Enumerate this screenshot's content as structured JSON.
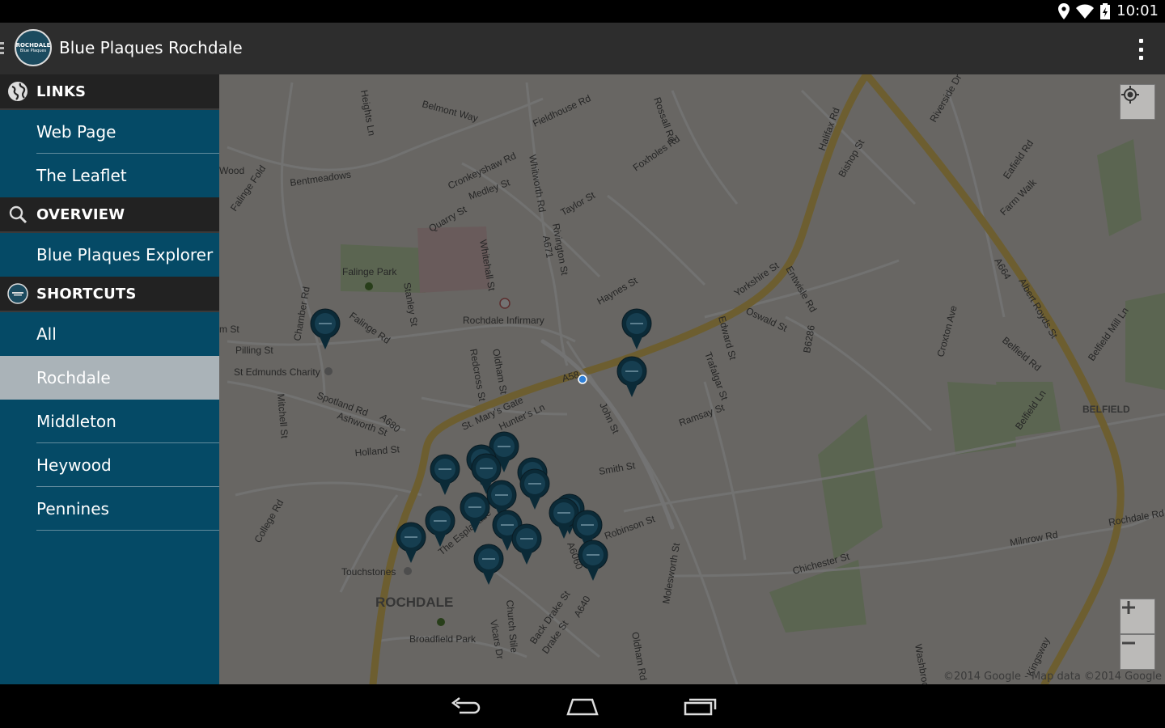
{
  "status_bar": {
    "time": "10:01",
    "icons": [
      "location-icon",
      "wifi-icon",
      "battery-icon"
    ]
  },
  "app": {
    "title": "Blue Plaques Rochdale",
    "logo_line1": "ROCHDALE",
    "logo_line2": "Blue Plaques"
  },
  "drawer": {
    "links_header": "LINKS",
    "links": [
      "Web Page",
      "The Leaflet"
    ],
    "overview_header": "OVERVIEW",
    "overview": [
      "Blue Plaques Explorer"
    ],
    "shortcuts_header": "SHORTCUTS",
    "shortcuts": [
      "All",
      "Rochdale",
      "Middleton",
      "Heywood",
      "Pennines"
    ],
    "selected": "Rochdale"
  },
  "map": {
    "copyright": "©2014 Google - Map data ©2014 Google",
    "labels": [
      "Heights Ln",
      "Belmont Way",
      "Fieldhouse Rd",
      "Rossall Rd",
      "Riverside Dr",
      "Halifax Rd",
      "Bishop St",
      "Foxholes Rd",
      "Bentmeadows",
      "Cronkeyshaw Rd",
      "Medley St",
      "Whitworth Rd",
      "Taylor St",
      "Falinge Fold",
      "Quarry St",
      "Eafield Rd",
      "Farm Walk",
      "Whitehall St",
      "Rivington St",
      "A671",
      "Falinge Park",
      "Stanley St",
      "Haynes St",
      "Yorkshire St",
      "Entwisle Rd",
      "Oswald St",
      "Rochdale Infirmary",
      "Edward St",
      "Falinge Rd",
      "Pilling St",
      "St Edmunds Charity",
      "Trafalgar St",
      "B6286",
      "Croxton Ave",
      "A664",
      "Albert Royds St",
      "Belfield Rd",
      "Belfield Mill Ln",
      "A58",
      "John St",
      "Spotland Rd",
      "Ashworth St",
      "A680",
      "St. Mary's Gate",
      "Hunter's Ln",
      "Ramsay St",
      "BELFIELD",
      "Holland St",
      "Smith St",
      "Belfield Ln",
      "Mitchell St",
      "College Rd",
      "Robinson St",
      "Rochdale Rd",
      "Milnrow Rd",
      "The Esplanade",
      "A6060",
      "Touchstones",
      "ROCHDALE",
      "Chichester St",
      "Molesworth St",
      "Broadfield Park",
      "Church Stile",
      "Vicars Dr",
      "Back Drake St",
      "Drake St",
      "A640",
      "Oldham Rd",
      "Kingsway",
      "Washbrook",
      "Wood",
      "m St",
      "Redcross St",
      "Oldham St",
      "Chamber Rd"
    ]
  },
  "nav": [
    "back-button",
    "home-button",
    "recents-button"
  ]
}
